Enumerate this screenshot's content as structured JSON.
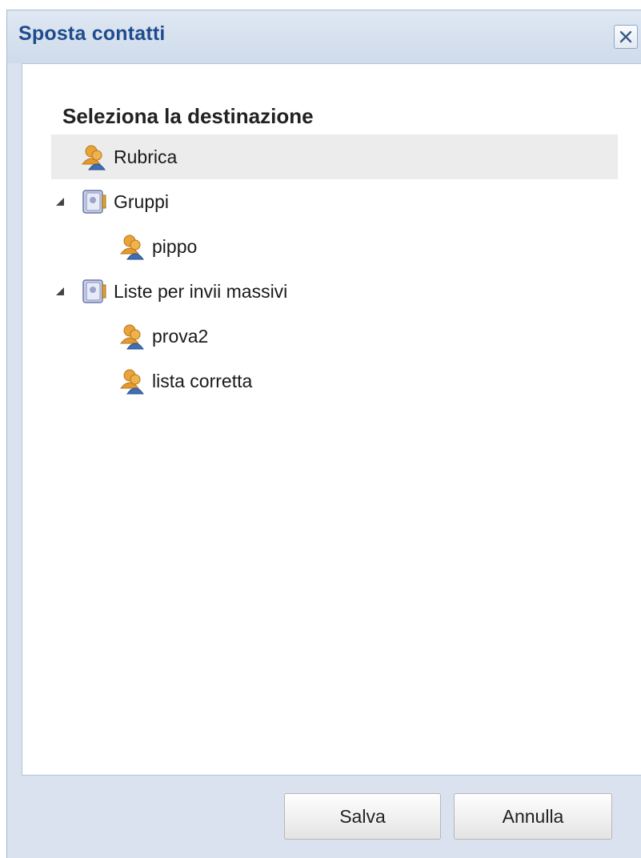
{
  "dialog": {
    "title": "Sposta contatti",
    "close_icon": "close-icon"
  },
  "content": {
    "section_title": "Seleziona la destinazione",
    "tree": {
      "rubrica": {
        "label": "Rubrica",
        "icon": "contacts-icon",
        "selected": true
      },
      "gruppi": {
        "label": "Gruppi",
        "icon": "address-book-icon",
        "expanded": true,
        "children": [
          {
            "label": "pippo",
            "icon": "contacts-icon"
          }
        ]
      },
      "liste": {
        "label": "Liste per invii massivi",
        "icon": "address-book-icon",
        "expanded": true,
        "children": [
          {
            "label": "prova2",
            "icon": "contacts-icon"
          },
          {
            "label": "lista corretta",
            "icon": "contacts-icon"
          }
        ]
      }
    }
  },
  "footer": {
    "save_label": "Salva",
    "cancel_label": "Annulla"
  }
}
